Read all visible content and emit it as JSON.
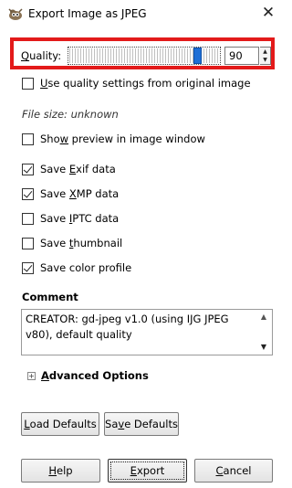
{
  "window": {
    "title": "Export Image as JPEG",
    "app_icon": "gimp-icon",
    "close_glyph": "✕"
  },
  "quality": {
    "label_u": "Q",
    "label_rest": "uality:",
    "value": "90",
    "slider_fraction": 0.9
  },
  "options": [
    {
      "u": "U",
      "rest": "se quality settings from original image",
      "checked": false
    },
    {
      "pre": "Sho",
      "u": "w",
      "rest": " preview in image window",
      "checked": false
    },
    {
      "pre": "Save ",
      "u": "E",
      "rest": "xif data",
      "checked": true
    },
    {
      "pre": "Save ",
      "u": "X",
      "rest": "MP data",
      "checked": true
    },
    {
      "pre": "Save ",
      "u": "I",
      "rest": "PTC data",
      "checked": false
    },
    {
      "pre": "Save ",
      "u": "t",
      "rest": "humbnail",
      "checked": false
    },
    {
      "pre": "Save color profile",
      "u": "",
      "rest": "",
      "checked": true
    }
  ],
  "file_size": "File size: unknown",
  "comment": {
    "heading": "Comment",
    "text": "CREATOR: gd-jpeg v1.0 (using IJG JPEG v80), default quality"
  },
  "advanced": {
    "u": "A",
    "rest": "dvanced Options",
    "expander": "+"
  },
  "buttons": {
    "load_u": "L",
    "load_rest": "oad Defaults",
    "save_pre": "Sa",
    "save_u": "v",
    "save_rest": "e Defaults",
    "help_u": "H",
    "help_rest": "elp",
    "export_u": "E",
    "export_rest": "xport",
    "cancel_u": "C",
    "cancel_rest": "ancel"
  }
}
